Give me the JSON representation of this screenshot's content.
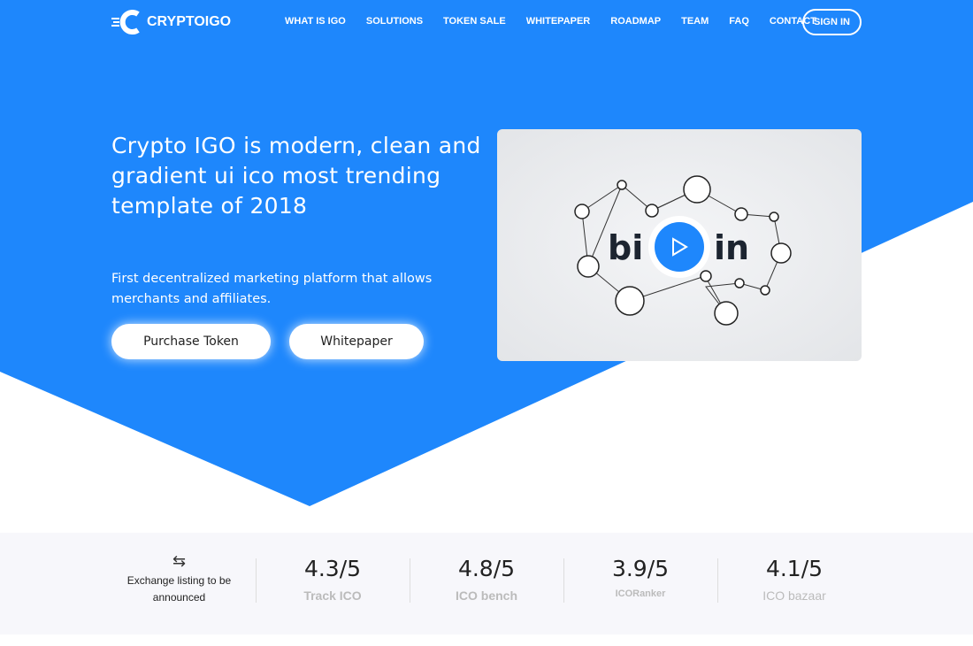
{
  "colors": {
    "brand_blue": "#1e87fc",
    "white": "#ffffff"
  },
  "nav": {
    "logo": "CRYPTOIGO",
    "items": [
      "WHAT IS IGO",
      "SOLUTIONS",
      "TOKEN SALE",
      "WHITEPAPER",
      "ROADMAP",
      "TEAM",
      "FAQ",
      "CONTACT"
    ],
    "signin": "SIGN IN"
  },
  "hero": {
    "title": "Crypto IGO is modern, clean and gradient ui ico most trending template of 2018",
    "subtitle": "First decentralized marketing platform that allows merchants and affiliates.",
    "purchase": "Purchase Token",
    "whitepaper": "Whitepaper",
    "video_text_left": "bi",
    "video_text_right": "in",
    "video_icon": "play-icon"
  },
  "stats": {
    "exchange": "Exchange listing to be announced",
    "ratings": [
      {
        "value": "4.3/5",
        "brand": "Track ICO"
      },
      {
        "value": "4.8/5",
        "brand": "ICO bench"
      },
      {
        "value": "3.9/5",
        "brand": "ICORanker"
      },
      {
        "value": "4.1/5",
        "brand": "ICO bazaar"
      }
    ]
  }
}
